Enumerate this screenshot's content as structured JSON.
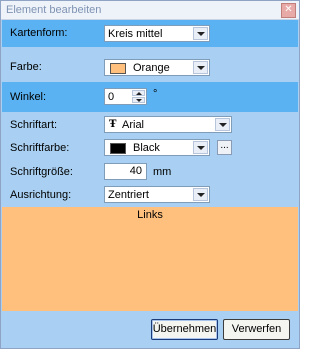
{
  "window": {
    "title": "Element bearbeiten",
    "close_icon": "close-icon"
  },
  "form": {
    "kartenform": {
      "label": "Kartenform:",
      "value": "Kreis mittel"
    },
    "farbe": {
      "label": "Farbe:",
      "value": "Orange",
      "swatch_color": "#ffc07e"
    },
    "winkel": {
      "label": "Winkel:",
      "value": "0",
      "unit": "°"
    },
    "schriftart": {
      "label": "Schriftart:",
      "value": "Arial",
      "icon": "truetype-font-icon"
    },
    "schriftfarbe": {
      "label": "Schriftfarbe:",
      "value": "Black",
      "swatch_color": "#000000",
      "more_label": "..."
    },
    "schriftgroesse": {
      "label": "Schriftgröße:",
      "value": "40",
      "unit": "mm"
    },
    "ausrichtung": {
      "label": "Ausrichtung:",
      "value": "Zentriert"
    }
  },
  "preview": {
    "text": "Links",
    "background": "#ffc07e"
  },
  "buttons": {
    "apply": "Übernehmen",
    "discard": "Verwerfen"
  },
  "colors": {
    "band": "#5ab2f2",
    "plain": "#a9d0f2"
  }
}
